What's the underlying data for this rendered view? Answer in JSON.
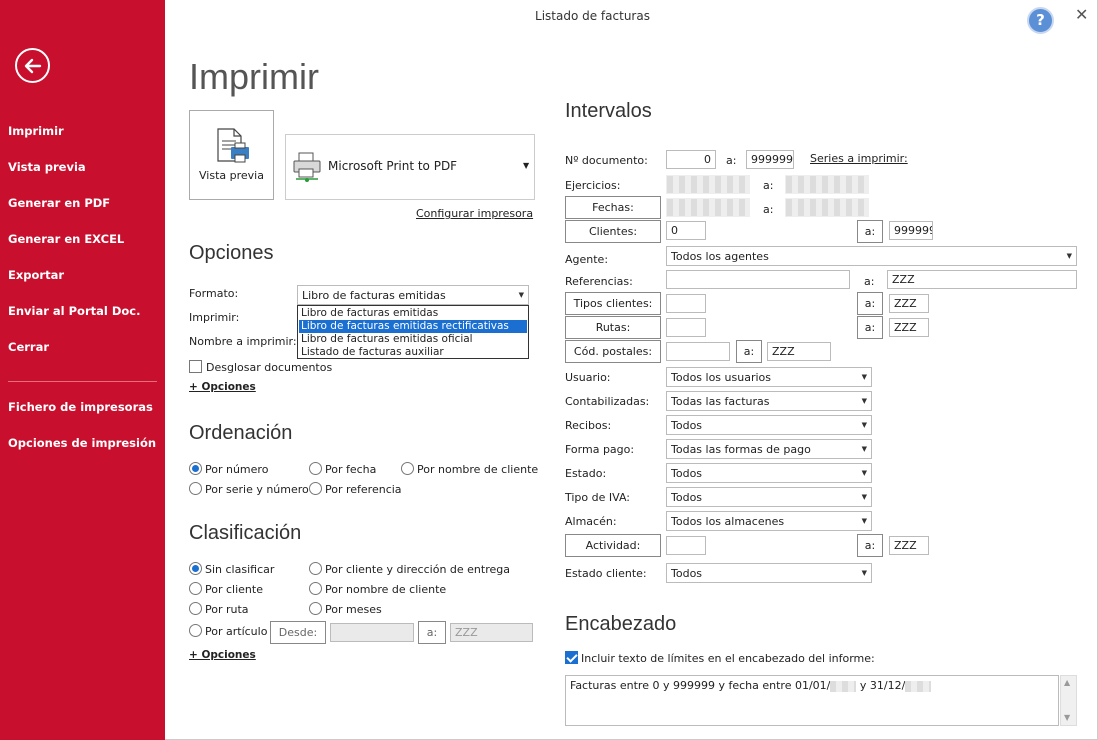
{
  "window": {
    "title": "Listado de facturas"
  },
  "sidebar": {
    "items": [
      {
        "label": "Imprimir"
      },
      {
        "label": "Vista previa"
      },
      {
        "label": "Generar en PDF"
      },
      {
        "label": "Generar en EXCEL"
      },
      {
        "label": "Exportar"
      },
      {
        "label": "Enviar al Portal Doc."
      },
      {
        "label": "Cerrar"
      },
      {
        "label": "Fichero de impresoras"
      },
      {
        "label": "Opciones de impresión"
      }
    ]
  },
  "print": {
    "heading": "Imprimir",
    "preview_label": "Vista previa",
    "printer_name": "Microsoft Print to PDF",
    "configure_link": "Configurar impresora"
  },
  "options": {
    "heading": "Opciones",
    "formato_label": "Formato:",
    "formato_value": "Libro de facturas emitidas",
    "formato_options": [
      "Libro de facturas emitidas",
      "Libro de facturas emitidas rectificativas",
      "Libro de facturas emitidas oficial",
      "Listado de facturas auxiliar"
    ],
    "imprimir_label": "Imprimir:",
    "nombre_label": "Nombre a imprimir:",
    "desglosar_label": "Desglosar documentos",
    "more_link": "+ Opciones"
  },
  "ordenacion": {
    "heading": "Ordenación",
    "options": [
      "Por número",
      "Por fecha",
      "Por nombre de cliente",
      "Por serie y número",
      "Por referencia"
    ],
    "selected": "Por número"
  },
  "clasificacion": {
    "heading": "Clasificación",
    "options": [
      "Sin clasificar",
      "Por cliente y dirección de entrega",
      "Por cliente",
      "Por nombre de cliente",
      "Por ruta",
      "Por meses",
      "Por artículo"
    ],
    "selected": "Sin clasificar",
    "desde_label": "Desde:",
    "a_label": "a:",
    "hasta_value": "ZZZ",
    "more_link": "+ Opciones"
  },
  "intervalos": {
    "heading": "Intervalos",
    "a": "a:",
    "documento_label": "Nº documento:",
    "documento_from": "0",
    "documento_to": "999999",
    "series_link": "Series a imprimir:",
    "ejercicios_label": "Ejercicios:",
    "fechas_label": "Fechas:",
    "clientes_label": "Clientes:",
    "clientes_from": "0",
    "clientes_to": "999999",
    "agente_label": "Agente:",
    "agente_value": "Todos los agentes",
    "referencias_label": "Referencias:",
    "referencias_to": "ZZZ",
    "tipos_clientes_label": "Tipos clientes:",
    "tipos_clientes_to": "ZZZ",
    "rutas_label": "Rutas:",
    "rutas_to": "ZZZ",
    "cod_postales_label": "Cód. postales:",
    "cod_postales_to": "ZZZ",
    "usuario_label": "Usuario:",
    "usuario_value": "Todos los usuarios",
    "contabilizadas_label": "Contabilizadas:",
    "contabilizadas_value": "Todas las facturas",
    "recibos_label": "Recibos:",
    "recibos_value": "Todos",
    "forma_pago_label": "Forma pago:",
    "forma_pago_value": "Todas las formas de pago",
    "estado_label": "Estado:",
    "estado_value": "Todos",
    "tipo_iva_label": "Tipo de IVA:",
    "tipo_iva_value": "Todos",
    "almacen_label": "Almacén:",
    "almacen_value": "Todos los almacenes",
    "actividad_label": "Actividad:",
    "actividad_to": "ZZZ",
    "estado_cliente_label": "Estado cliente:",
    "estado_cliente_value": "Todos"
  },
  "encabezado": {
    "heading": "Encabezado",
    "include_label": "Incluir texto de límites en el encabezado del informe:",
    "text_part1": "Facturas entre 0 y 999999 y fecha entre 01/01/",
    "text_part2": " y 31/12/"
  }
}
